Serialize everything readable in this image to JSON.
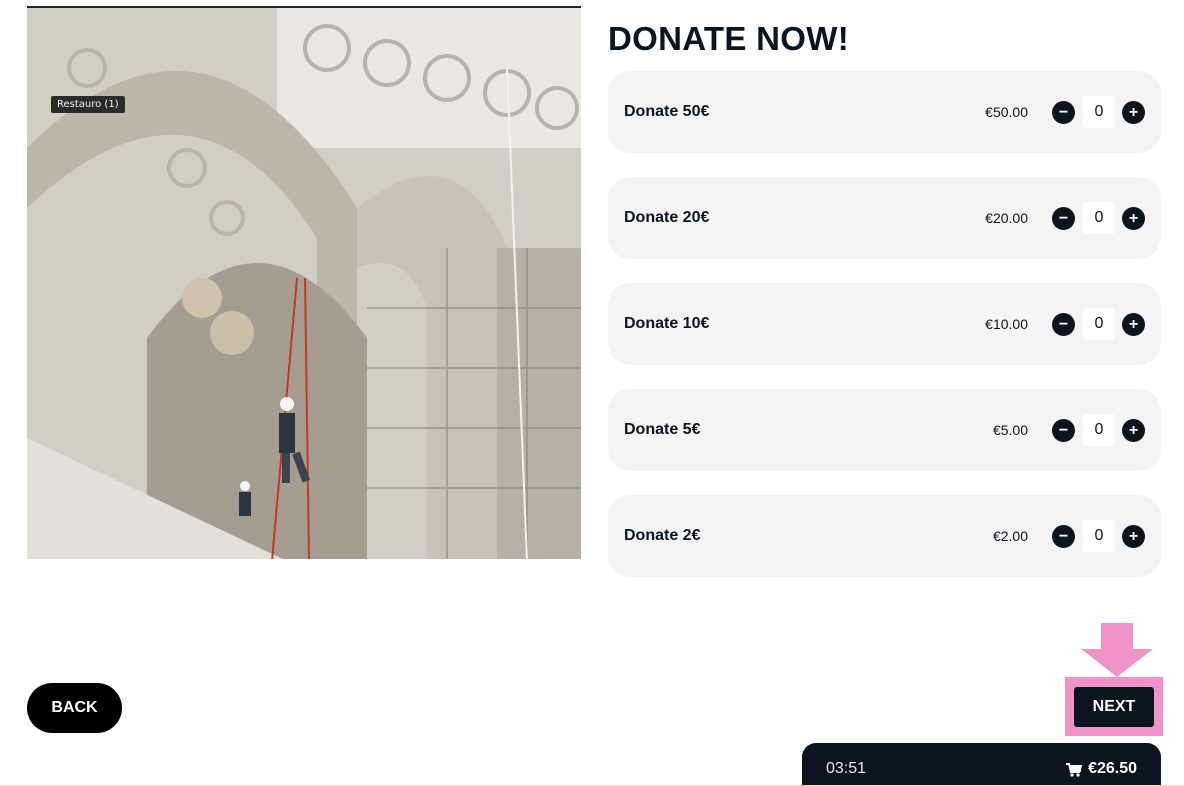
{
  "photo": {
    "tag": "Restauro (1)"
  },
  "title": "DONATE NOW!",
  "donations": [
    {
      "label": "Donate 50€",
      "price": "€50.00",
      "quantity": "0",
      "minus": "−",
      "plus": "+"
    },
    {
      "label": "Donate 20€",
      "price": "€20.00",
      "quantity": "0",
      "minus": "−",
      "plus": "+"
    },
    {
      "label": "Donate 10€",
      "price": "€10.00",
      "quantity": "0",
      "minus": "−",
      "plus": "+"
    },
    {
      "label": "Donate 5€",
      "price": "€5.00",
      "quantity": "0",
      "minus": "−",
      "plus": "+"
    },
    {
      "label": "Donate 2€",
      "price": "€2.00",
      "quantity": "0",
      "minus": "−",
      "plus": "+"
    }
  ],
  "nav": {
    "back_label": "BACK",
    "next_label": "NEXT"
  },
  "cart": {
    "timer": "03:51",
    "total": "€26.50",
    "icon": "cart-icon"
  },
  "colors": {
    "accent_dark": "#0b1520",
    "highlight_pink": "#f093c8",
    "row_bg": "#f4f4f5"
  }
}
